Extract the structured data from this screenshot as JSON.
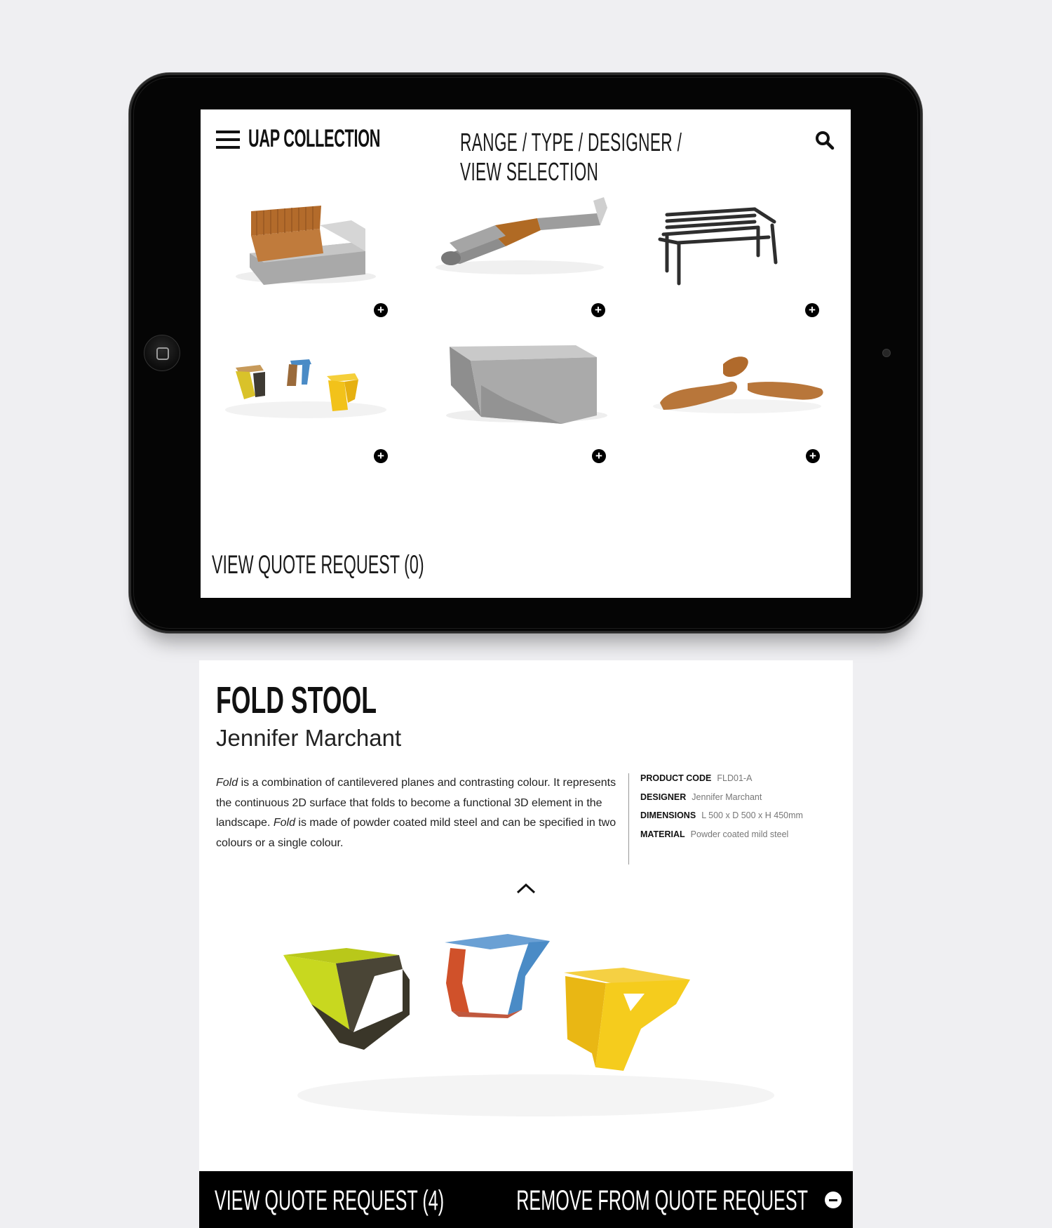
{
  "app": {
    "brand": "UAP COLLECTION",
    "nav": "RANGE / TYPE / DESIGNER / VIEW SELECTION"
  },
  "grid": {
    "products": [
      {
        "name": "timber-and-stone-bench"
      },
      {
        "name": "angled-stone-bench"
      },
      {
        "name": "steel-park-bench"
      },
      {
        "name": "fold-stool-set"
      },
      {
        "name": "granite-block-bench"
      },
      {
        "name": "curved-timber-seats"
      }
    ],
    "quote_link": "VIEW QUOTE REQUEST (0)"
  },
  "detail": {
    "title": "FOLD STOOL",
    "designer": "Jennifer Marchant",
    "description": {
      "p1_italic": "Fold",
      "p1": " is a combination of cantilevered planes and contrasting colour. It represents the continuous 2D surface that folds to become a functional 3D element in the landscape. ",
      "p2_italic": "Fold",
      "p2": " is made of powder coated mild steel and can be specified in two colours or a single colour."
    },
    "specs": [
      {
        "label": "PRODUCT CODE",
        "value": "FLD01-A"
      },
      {
        "label": "DESIGNER",
        "value": "Jennifer Marchant"
      },
      {
        "label": "DIMENSIONS",
        "value": "L 500 x D 500 x H 450mm"
      },
      {
        "label": "MATERIAL",
        "value": "Powder coated mild steel"
      }
    ],
    "view_quote": "VIEW QUOTE REQUEST (4)",
    "remove_quote": "REMOVE FROM QUOTE REQUEST"
  },
  "colors": {
    "accent": "#000000",
    "timber": "#b8763a",
    "stone": "#9a9a9a",
    "lime": "#c8d81f",
    "blue": "#4a8bc6",
    "orange": "#d0512a",
    "yellow": "#f2c21a"
  }
}
